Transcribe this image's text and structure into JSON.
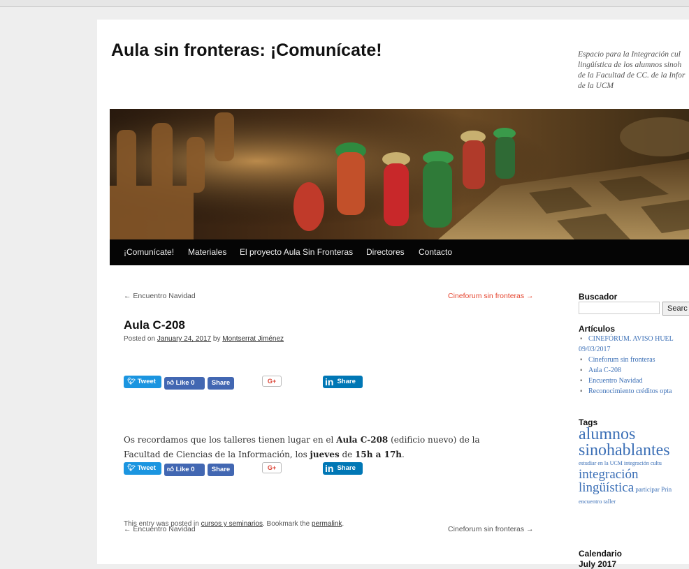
{
  "site": {
    "title": "Aula sin fronteras: ¡Comunícate!",
    "description": "Espacio para la Integración cul\nlingüística de los alumnos sinoh\nde la Facultad de CC. de la Infor\nde la UCM"
  },
  "nav": [
    "¡Comunícate!",
    "Materiales",
    "El proyecto Aula Sin Fronteras",
    "Directores",
    "Contacto"
  ],
  "post_nav": {
    "prev": "← Encuentro Navidad",
    "next": "Cineforum sin fronteras →"
  },
  "post": {
    "title": "Aula C-208",
    "posted_on_label": "Posted on",
    "date": "January 24, 2017",
    "by_label": "by",
    "author": "Montserrat Jiménez",
    "body": {
      "t1": "Os recordamos que los talleres tienen lugar en el ",
      "b1": "Aula C-208",
      "t2": " (edificio nuevo) de la Facultad de Ciencias de la Información, los ",
      "b2": "jueves",
      "t3": " de ",
      "b3": "15h a 17h",
      "t4": "."
    }
  },
  "share": {
    "tweet": "Tweet",
    "like": "Like 0",
    "share": "Share",
    "gplus": "G+",
    "linkedin_share": "Share"
  },
  "footer": {
    "prefix": "This entry was posted in ",
    "category": "cursos y seminarios",
    "middle": ". Bookmark the ",
    "permalink": "permalink",
    "suffix": "."
  },
  "sidebar": {
    "search_title": "Buscador",
    "search_button": "Searc",
    "articles_title": "Artículos",
    "articles": [
      "CINEFÓRUM. AVISO HUEL",
      "09/03/2017",
      "Cineforum sin fronteras",
      "Aula C-208",
      "Encuentro Navidad",
      "Reconocimiento créditos opta"
    ],
    "tags_title": "Tags",
    "tags": {
      "big1": "alumnos",
      "big2": "sinohablantes",
      "small1": "estudiar en la UCM integración cultu",
      "mid": "integración",
      "mid2": "lingüística",
      "small2": " participar Prin",
      "small3": "encuentro taller"
    },
    "calendar_title": "Calendario",
    "calendar_month": "July 2017"
  },
  "colors": {
    "accent_link": "#e5452f",
    "nav_bg": "#050505",
    "tag_blue": "#3b6fb6",
    "twitter": "#1b95e0",
    "facebook": "#4267b2",
    "linkedin": "#0077b5"
  }
}
